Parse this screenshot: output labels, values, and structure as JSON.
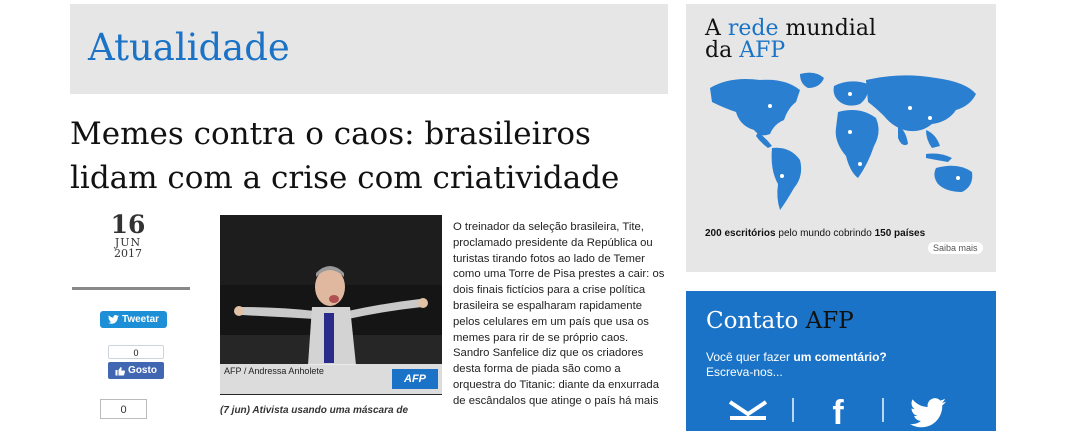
{
  "section": {
    "title": "Atualidade"
  },
  "article": {
    "headline": "Memes contra o caos: brasileiros lidam com a crise com criatividade",
    "date": {
      "day": "16",
      "month": "JUN",
      "year": "2017"
    },
    "photo_credit": "AFP / Andressa Anholete",
    "photo_logo": "AFP",
    "caption": "(7 jun) Ativista usando uma máscara de",
    "body": "O treinador da seleção brasileira, Tite, proclamado presidente da República ou turistas tirando fotos ao lado de Temer como uma Torre de Pisa prestes a cair: os dois finais fictícios para a crise política brasileira se espalharam rapidamente pelos celulares em um país que usa os memes para rir de se próprio caos. Sandro Sanfelice diz que os criadores desta forma de piada são como a orquestra do Titanic: diante da enxurrada de escândalos que atinge o país há mais"
  },
  "social": {
    "tweet_label": "Tweetar",
    "fb_count": "0",
    "fb_like_label": "Gosto",
    "share_count": "0"
  },
  "sidebar": {
    "map": {
      "title_a": "A ",
      "title_highlight1": "rede",
      "title_b": " mundial",
      "title_c": "da ",
      "title_highlight2": "AFP",
      "stat_num1": "200 escritórios",
      "stat_mid": " pelo mundo cobrindo ",
      "stat_num2": "150 países",
      "more_label": "Saiba mais"
    },
    "contact": {
      "title_a": "Contato ",
      "title_highlight": "AFP",
      "text_a": "Você quer fazer ",
      "text_bold": "um comentário?",
      "text_b": "Escreva-nos...",
      "icons": [
        "mail-icon",
        "facebook-icon",
        "twitter-icon"
      ]
    }
  },
  "colors": {
    "accent": "#1a73c6",
    "panel": "#e6e6e6",
    "tweet": "#1d8fd6",
    "facebook": "#4267b2"
  }
}
